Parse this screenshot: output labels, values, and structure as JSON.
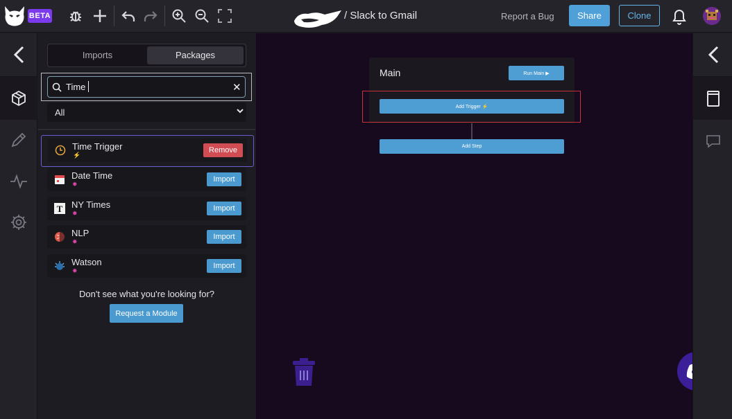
{
  "topbar": {
    "beta_label": "BETA",
    "title": "/ Slack to Gmail",
    "report_label": "Report a Bug",
    "share_label": "Share",
    "clone_label": "Clone"
  },
  "panel": {
    "tabs": [
      {
        "label": "Imports",
        "active": false
      },
      {
        "label": "Packages",
        "active": true
      }
    ],
    "search": {
      "value": "Time"
    },
    "filter": {
      "value": "All"
    },
    "packages": [
      {
        "name": "Time Trigger",
        "sub": "⚡",
        "action": "Remove",
        "icon": "clock-icon"
      },
      {
        "name": "Date Time",
        "sub": "✸",
        "action": "Import",
        "icon": "calendar-icon"
      },
      {
        "name": "NY Times",
        "sub": "✸",
        "action": "Import",
        "icon": "nytimes-icon"
      },
      {
        "name": "NLP",
        "sub": "✸",
        "action": "Import",
        "icon": "brain-icon"
      },
      {
        "name": "Watson",
        "sub": "✸",
        "action": "Import",
        "icon": "watson-icon"
      }
    ],
    "not_found_text": "Don't see what you're looking for?",
    "request_label": "Request a Module"
  },
  "canvas": {
    "main_title": "Main",
    "run_label": "Run Main  ▶",
    "add_trigger_label": "Add Trigger  ⚡",
    "add_step_label": "Add Step"
  },
  "colors": {
    "accent": "#4e9dd3",
    "beta": "#7c3aed",
    "remove": "#d24c53",
    "canvas_bg": "#170a1f"
  }
}
